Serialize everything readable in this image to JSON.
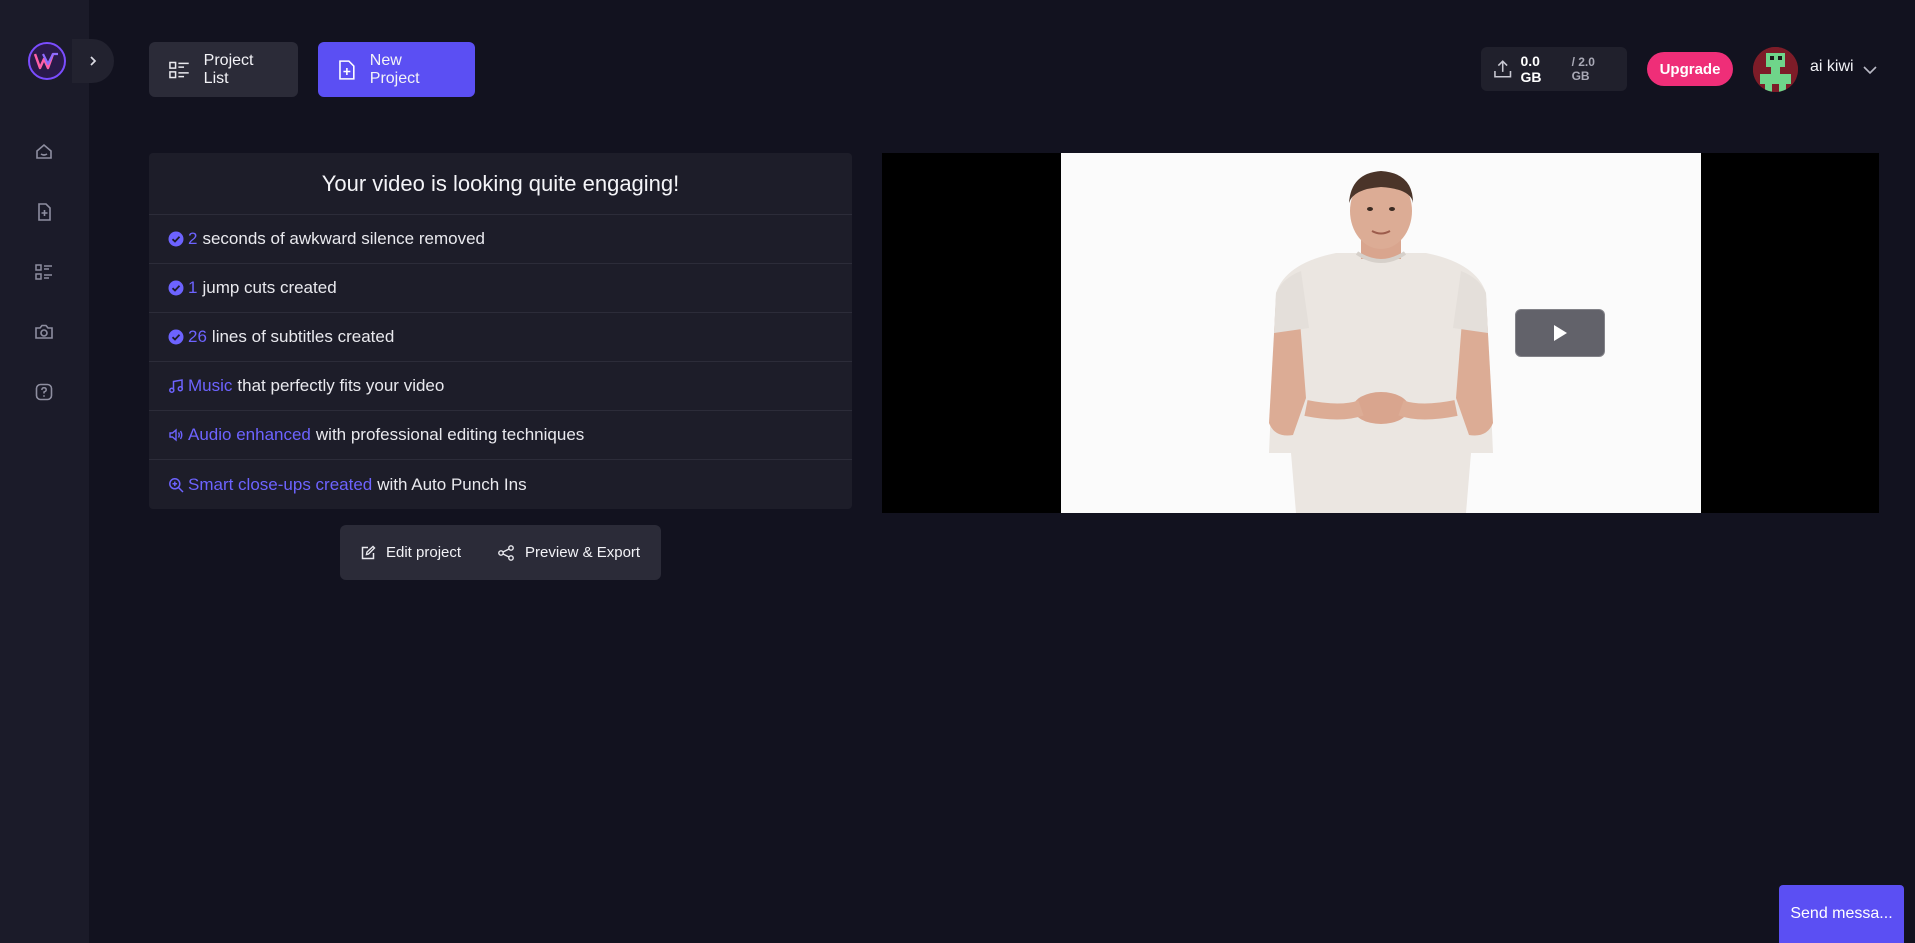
{
  "header": {
    "project_list_label": "Project List",
    "new_project_label": "New Project",
    "storage_used": "0.0 GB",
    "storage_total": "/ 2.0 GB",
    "upgrade_label": "Upgrade",
    "username": "ai kiwi"
  },
  "sidebar": {
    "items": [
      {
        "icon": "home-icon"
      },
      {
        "icon": "new-file-icon"
      },
      {
        "icon": "list-icon"
      },
      {
        "icon": "camera-icon"
      },
      {
        "icon": "help-icon"
      }
    ]
  },
  "summary": {
    "title": "Your video is looking quite engaging!",
    "rows": [
      {
        "icon": "check-circle-icon",
        "highlight": "2",
        "text": "seconds of awkward silence removed"
      },
      {
        "icon": "check-circle-icon",
        "highlight": "1",
        "text": "jump cuts created"
      },
      {
        "icon": "check-circle-icon",
        "highlight": "26",
        "text": "lines of subtitles created"
      },
      {
        "icon": "music-icon",
        "highlight": "Music",
        "text": "that perfectly fits your video"
      },
      {
        "icon": "speaker-icon",
        "highlight": "Audio enhanced",
        "text": "with professional editing techniques"
      },
      {
        "icon": "zoom-in-icon",
        "highlight": "Smart close-ups created",
        "text": "with Auto Punch Ins"
      }
    ]
  },
  "actions": {
    "edit_label": "Edit project",
    "export_label": "Preview & Export"
  },
  "chat": {
    "send_label": "Send messa..."
  },
  "colors": {
    "accent": "#5b4ff3",
    "highlight_text": "#6d63ff",
    "upgrade": "#ef2e78",
    "background": "#12121f",
    "sidebar": "#1b1b29"
  }
}
